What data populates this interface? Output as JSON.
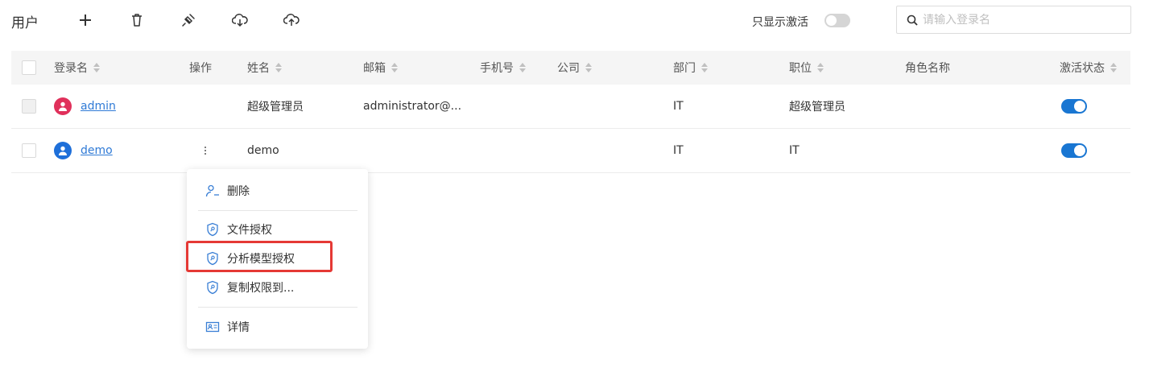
{
  "toolbar": {
    "title": "用户",
    "buttons": [
      "add-icon",
      "delete-icon",
      "plug-icon",
      "cloud-download-icon",
      "cloud-upload-icon"
    ],
    "only_active_label": "只显示激活",
    "only_active_on": false,
    "search_placeholder": "请输入登录名",
    "search_value": ""
  },
  "table": {
    "columns": [
      {
        "label": "登录名",
        "sortable": true
      },
      {
        "label": "操作",
        "sortable": false
      },
      {
        "label": "姓名",
        "sortable": true
      },
      {
        "label": "邮箱",
        "sortable": true
      },
      {
        "label": "手机号",
        "sortable": true
      },
      {
        "label": "公司",
        "sortable": true
      },
      {
        "label": "部门",
        "sortable": true
      },
      {
        "label": "职位",
        "sortable": true
      },
      {
        "label": "角色名称",
        "sortable": false
      },
      {
        "label": "激活状态",
        "sortable": true
      }
    ],
    "rows": [
      {
        "login": "admin",
        "name": "超级管理员",
        "email": "administrator@...",
        "phone": "",
        "company": "",
        "department": "IT",
        "position": "超级管理员",
        "role": "",
        "active": true,
        "avatar_color": "#e0305b",
        "checkbox_disabled": true
      },
      {
        "login": "demo",
        "name": "demo",
        "email": "",
        "phone": "",
        "company": "",
        "department": "IT",
        "position": "IT",
        "role": "",
        "active": true,
        "avatar_color": "#1e6fd9",
        "checkbox_disabled": false
      }
    ]
  },
  "context_menu": {
    "items": [
      {
        "label": "删除",
        "icon": "user-remove-icon"
      },
      {
        "label": "文件授权",
        "icon": "shield-key-icon"
      },
      {
        "label": "分析模型授权",
        "icon": "shield-key-icon",
        "highlighted": true
      },
      {
        "label": "复制权限到...",
        "icon": "shield-key-icon"
      },
      {
        "label": "详情",
        "icon": "id-card-icon"
      }
    ]
  },
  "colors": {
    "accent": "#1976d2",
    "link": "#2f7ad6",
    "highlight_border": "#e53935",
    "header_bg": "#f5f5f5"
  }
}
